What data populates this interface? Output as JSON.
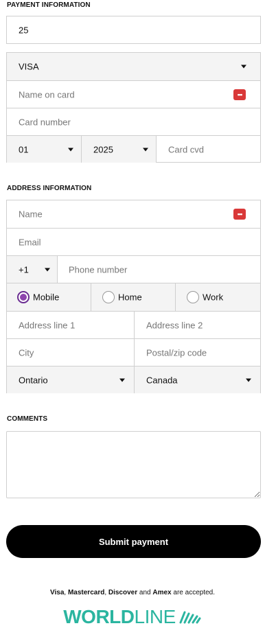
{
  "payment": {
    "section_title": "PAYMENT INFORMATION",
    "amount_value": "25",
    "card_type": "VISA",
    "name_on_card_placeholder": "Name on card",
    "card_number_placeholder": "Card number",
    "exp_month": "01",
    "exp_year": "2025",
    "cvd_placeholder": "Card cvd"
  },
  "address": {
    "section_title": "ADDRESS INFORMATION",
    "name_placeholder": "Name",
    "email_placeholder": "Email",
    "phone_code": "+1",
    "phone_placeholder": "Phone number",
    "phone_types": [
      {
        "label": "Mobile",
        "checked": true
      },
      {
        "label": "Home",
        "checked": false
      },
      {
        "label": "Work",
        "checked": false
      }
    ],
    "address_line1_placeholder": "Address line 1",
    "address_line2_placeholder": "Address line 2",
    "city_placeholder": "City",
    "postal_placeholder": "Postal/zip code",
    "province": "Ontario",
    "country": "Canada"
  },
  "comments": {
    "section_title": "COMMENTS",
    "value": ""
  },
  "submit_label": "Submit payment",
  "accepted": {
    "brand1": "Visa",
    "sep1": ", ",
    "brand2": "Mastercard",
    "sep2": ", ",
    "brand3": "Discover",
    "and": " and ",
    "brand4": "Amex",
    "suffix": " are accepted."
  },
  "logo": {
    "bold_part": "WORLD",
    "light_part": "LINE",
    "color": "#2bb5a0"
  },
  "icons": {
    "password_manager": "password-manager-icon",
    "dropdown": "chevron-down-icon",
    "resize": "resize-handle-icon",
    "logo_waves": "worldline-waves-icon"
  },
  "colors": {
    "accent": "#8e44ad",
    "manager_icon": "#d93838",
    "submit_bg": "#000000"
  }
}
